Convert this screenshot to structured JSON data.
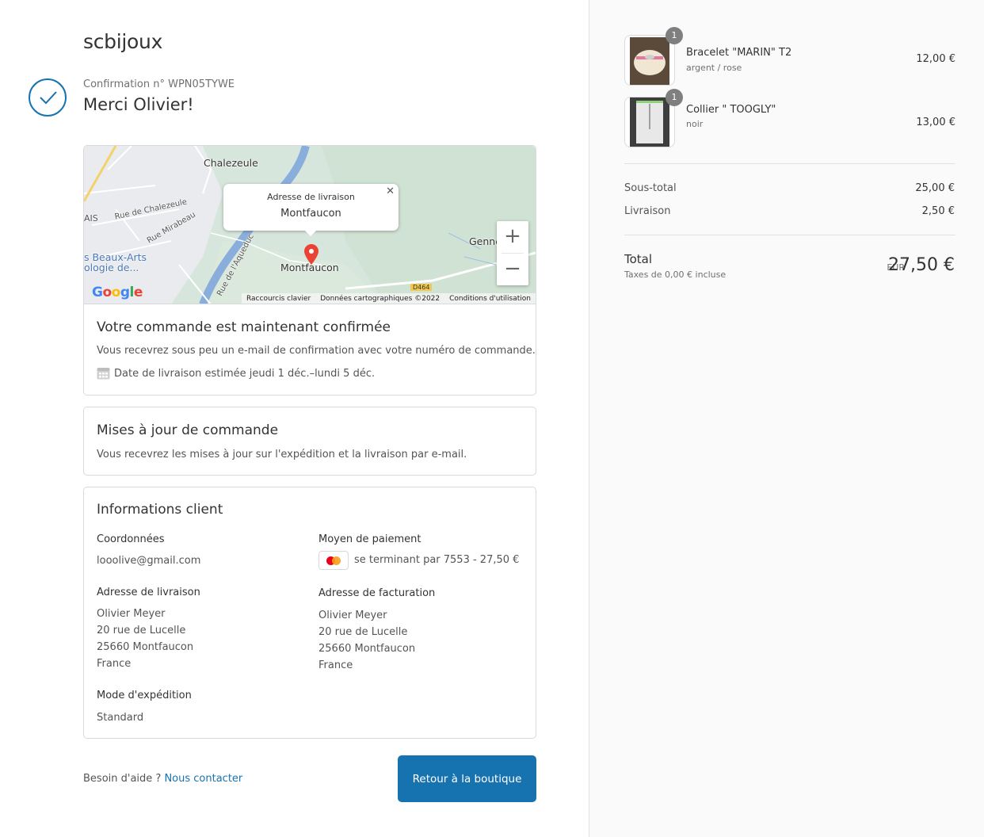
{
  "shop": {
    "name": "scbijoux"
  },
  "header": {
    "confirmation": "Confirmation n° WPN05TYWE",
    "thanks": "Merci Olivier!"
  },
  "map": {
    "popup_title": "Adresse de livraison",
    "popup_value": "Montfaucon",
    "labels": {
      "chalezeule": "Chalezeule",
      "montfaucon": "Montfaucon",
      "genne": "Genne",
      "ais": "AIS",
      "rue_chalezeule": "Rue de Chalezeule",
      "rue_mirabeau": "Rue Mirabeau",
      "rue_aqueduc": "Rue de l'Aqueduc",
      "beaux_arts_1": "s Beaux-Arts",
      "beaux_arts_2": "ologie de...",
      "road": "D464"
    },
    "google": "Google",
    "footer": [
      "Raccourcis clavier",
      "Données cartographiques ©2022",
      "Conditions d'utilisation"
    ],
    "zoom_in": "+",
    "zoom_out": "−"
  },
  "confirmed": {
    "title": "Votre commande est maintenant confirmée",
    "text": "Vous recevrez sous peu un e-mail de confirmation avec votre numéro de commande.",
    "delivery": "Date de livraison estimée jeudi 1 déc.–lundi 5 déc."
  },
  "updates": {
    "title": "Mises à jour de commande",
    "text": "Vous recevrez les mises à jour sur l'expédition et la livraison par e-mail."
  },
  "customer": {
    "title": "Informations client",
    "contact_label": "Coordonnées",
    "contact_value": "looolive@gmail.com",
    "payment_label": "Moyen de paiement",
    "payment_value": "se terminant par 7553 - 27,50 €",
    "shipping_label": "Adresse de livraison",
    "shipping_lines": [
      "Olivier Meyer",
      "20 rue de Lucelle",
      "25660 Montfaucon",
      "France"
    ],
    "billing_label": "Adresse de facturation",
    "billing_lines": [
      "Olivier Meyer",
      "20 rue de Lucelle",
      "25660 Montfaucon",
      "France"
    ],
    "method_label": "Mode d'expédition",
    "method_value": "Standard"
  },
  "footer": {
    "help": "Besoin d'aide ?",
    "contact_link": "Nous contacter",
    "return_button": "Retour à la boutique"
  },
  "summary": {
    "items": [
      {
        "name": "Bracelet \"MARIN\" T2",
        "variant": "argent / rose",
        "price": "12,00 €",
        "qty": "1"
      },
      {
        "name": "Collier \" TOOGLY\"",
        "variant": "noir",
        "price": "13,00 €",
        "qty": "1"
      }
    ],
    "subtotal_label": "Sous-total",
    "subtotal_value": "25,00 €",
    "shipping_label": "Livraison",
    "shipping_value": "2,50 €",
    "total_label": "Total",
    "taxes": "Taxes de 0,00 € incluse",
    "currency": "EUR",
    "total_value": "27,50 €"
  },
  "colors": {
    "accent": "#1773b0",
    "sidebar_bg": "#fafafa"
  }
}
